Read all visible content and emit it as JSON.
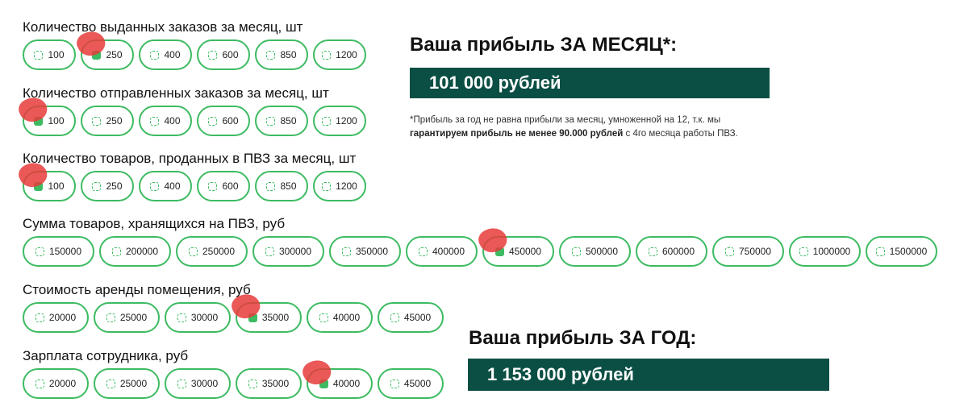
{
  "groups": [
    {
      "label": "Количество выданных заказов за месяц, шт",
      "options": [
        "100",
        "250",
        "400",
        "600",
        "850",
        "1200"
      ],
      "selected": "250"
    },
    {
      "label": "Количество отправленных заказов за месяц, шт",
      "options": [
        "100",
        "250",
        "400",
        "600",
        "850",
        "1200"
      ],
      "selected": "100"
    },
    {
      "label": "Количество товаров, проданных в ПВЗ за месяц, шт",
      "options": [
        "100",
        "250",
        "400",
        "600",
        "850",
        "1200"
      ],
      "selected": "100"
    },
    {
      "label": "Сумма товаров, хранящихся на ПВЗ, руб",
      "options": [
        "150000",
        "200000",
        "250000",
        "300000",
        "350000",
        "400000",
        "450000",
        "500000",
        "600000",
        "750000",
        "1000000",
        "1500000"
      ],
      "selected": "450000"
    },
    {
      "label": "Стоимость аренды помещения, руб",
      "options": [
        "20000",
        "25000",
        "30000",
        "35000",
        "40000",
        "45000"
      ],
      "selected": "35000"
    },
    {
      "label": "Зарплата сотрудника, руб",
      "options": [
        "20000",
        "25000",
        "30000",
        "35000",
        "40000",
        "45000"
      ],
      "selected": "40000"
    }
  ],
  "monthly": {
    "title": "Ваша прибыль ЗА МЕСЯЦ*:",
    "value": "101 000 рублей",
    "note_a": "*Прибыль за год не равна прибыли за месяц, умноженной на 12, т.к. мы ",
    "note_bold": "гарантируем прибыль не менее 90.000 рублей",
    "note_b": " с 4го месяца работы ПВЗ."
  },
  "yearly": {
    "title": "Ваша прибыль ЗА ГОД:",
    "value": "1 153 000 рублей"
  },
  "colors": {
    "accent": "#3dbb62",
    "result_bg": "#0b4f44"
  },
  "icons": {
    "option": "radio-dashed-square-icon"
  }
}
